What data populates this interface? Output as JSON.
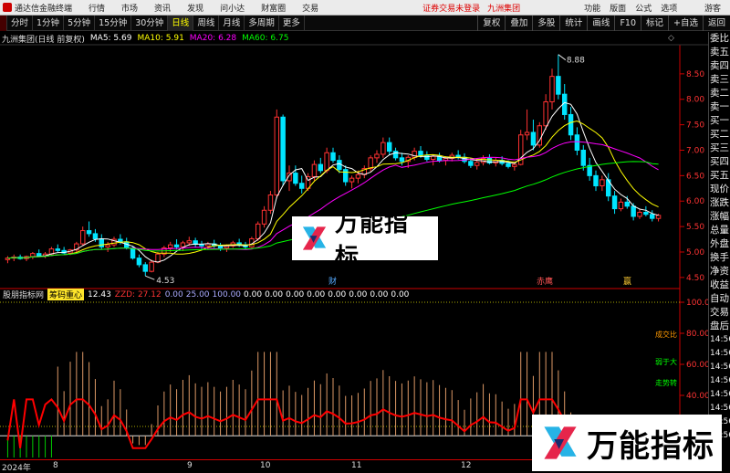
{
  "topbar": {
    "app_title": "通达信金融终端",
    "menus": [
      "行情",
      "市场",
      "资讯",
      "发现",
      "问小达",
      "财富圈",
      "交易"
    ],
    "notice": "证券交易未登录",
    "stock_name": "九洲集团",
    "right_menus": [
      "功能",
      "版面",
      "公式",
      "选项"
    ],
    "guest": "游客"
  },
  "periodbar": {
    "periods": [
      "分时",
      "1分钟",
      "5分钟",
      "15分钟",
      "30分钟",
      "日线",
      "周线",
      "月线",
      "多周期",
      "更多"
    ],
    "active": "日线",
    "right_buttons": [
      "复权",
      "叠加",
      "多股",
      "统计",
      "画线",
      "F10",
      "标记",
      "+自选",
      "返回"
    ]
  },
  "price_chart": {
    "title": "九洲集团(日线 前复权)",
    "ma": [
      {
        "label": "MA5: 5.69",
        "color": "#ffffff"
      },
      {
        "label": "MA10: 5.91",
        "color": "#ffff00"
      },
      {
        "label": "MA20: 6.28",
        "color": "#ff00ff"
      },
      {
        "label": "MA60: 6.75",
        "color": "#00ff00"
      }
    ],
    "high_label": "8.88",
    "low_label": "4.53",
    "y_ticks": [
      "8.50",
      "8.00",
      "7.50",
      "7.00",
      "6.50",
      "6.00",
      "5.50",
      "5.00",
      "4.50"
    ],
    "markers": [
      "财",
      "赤鹰",
      "赢"
    ]
  },
  "indicator": {
    "source": "股朋指标网",
    "tag": "筹码重心",
    "value": "12.43",
    "zzd": "ZZD: 27.12",
    "params": [
      "0.00",
      "25.00",
      "100.00",
      "0.00",
      "0.00",
      "0.00",
      "0.00",
      "0.00",
      "0.00",
      "0.00",
      "0.00"
    ],
    "y_ticks": [
      "100.00",
      "80.00",
      "60.00",
      "40.00",
      "20.00"
    ],
    "side_labels": [
      "成交比",
      "弱于大",
      "走势转"
    ]
  },
  "date_axis": [
    "2024年",
    "8",
    "9",
    "10",
    "11",
    "12"
  ],
  "right_panel": [
    "委比",
    "卖五",
    "卖四",
    "卖三",
    "卖二",
    "卖一",
    "买一",
    "买二",
    "买三",
    "买四",
    "买五",
    "现价",
    "涨跌",
    "涨幅",
    "总量",
    "外盘",
    "换手",
    "净资",
    "收益",
    "自动",
    "交易",
    "盘后",
    "14:56",
    "14:56",
    "14:56",
    "14:56",
    "14:56",
    "14:56",
    "14:56",
    "14:56"
  ],
  "watermark": "万能指标",
  "chart_data": [
    {
      "type": "candlestick",
      "title": "九洲集团(日线 前复权)",
      "ylim": [
        4.3,
        9.0
      ],
      "ohlc": [
        [
          4.85,
          4.92,
          4.78,
          4.88
        ],
        [
          4.88,
          4.95,
          4.82,
          4.9
        ],
        [
          4.9,
          4.95,
          4.85,
          4.87
        ],
        [
          4.87,
          4.93,
          4.82,
          4.91
        ],
        [
          4.91,
          5.0,
          4.86,
          4.97
        ],
        [
          4.97,
          5.05,
          4.9,
          4.92
        ],
        [
          4.92,
          5.0,
          4.88,
          4.96
        ],
        [
          4.96,
          5.1,
          4.93,
          5.06
        ],
        [
          5.06,
          5.15,
          5.0,
          5.03
        ],
        [
          5.03,
          5.1,
          4.96,
          4.98
        ],
        [
          4.98,
          5.06,
          4.94,
          5.04
        ],
        [
          5.04,
          5.2,
          5.0,
          5.16
        ],
        [
          5.16,
          5.5,
          5.12,
          5.42
        ],
        [
          5.42,
          5.6,
          5.3,
          5.36
        ],
        [
          5.36,
          5.45,
          5.2,
          5.26
        ],
        [
          5.26,
          5.35,
          5.05,
          5.1
        ],
        [
          5.1,
          5.2,
          5.0,
          5.14
        ],
        [
          5.14,
          5.3,
          5.1,
          5.25
        ],
        [
          5.25,
          5.35,
          5.15,
          5.2
        ],
        [
          5.2,
          5.28,
          5.05,
          5.08
        ],
        [
          5.08,
          5.12,
          4.85,
          4.88
        ],
        [
          4.88,
          4.95,
          4.7,
          4.75
        ],
        [
          4.75,
          4.8,
          4.53,
          4.62
        ],
        [
          4.62,
          4.85,
          4.6,
          4.8
        ],
        [
          4.8,
          5.0,
          4.78,
          4.96
        ],
        [
          4.96,
          5.12,
          4.9,
          5.08
        ],
        [
          5.08,
          5.2,
          5.0,
          5.14
        ],
        [
          5.14,
          5.25,
          5.05,
          5.1
        ],
        [
          5.1,
          5.22,
          5.02,
          5.18
        ],
        [
          5.18,
          5.3,
          5.12,
          5.22
        ],
        [
          5.22,
          5.28,
          5.1,
          5.15
        ],
        [
          5.15,
          5.22,
          5.05,
          5.12
        ],
        [
          5.12,
          5.2,
          5.04,
          5.16
        ],
        [
          5.16,
          5.24,
          5.08,
          5.12
        ],
        [
          5.12,
          5.18,
          5.02,
          5.08
        ],
        [
          5.08,
          5.15,
          5.0,
          5.12
        ],
        [
          5.12,
          5.22,
          5.08,
          5.18
        ],
        [
          5.18,
          5.26,
          5.1,
          5.14
        ],
        [
          5.14,
          5.2,
          5.06,
          5.1
        ],
        [
          5.1,
          5.3,
          5.08,
          5.26
        ],
        [
          5.26,
          5.6,
          5.22,
          5.55
        ],
        [
          5.55,
          5.9,
          5.48,
          5.82
        ],
        [
          5.82,
          6.2,
          5.75,
          6.12
        ],
        [
          6.12,
          7.8,
          6.05,
          7.65
        ],
        [
          7.65,
          7.7,
          6.3,
          6.4
        ],
        [
          6.4,
          6.7,
          6.2,
          6.55
        ],
        [
          6.55,
          6.7,
          6.3,
          6.35
        ],
        [
          6.35,
          6.5,
          6.15,
          6.25
        ],
        [
          6.25,
          6.55,
          6.2,
          6.48
        ],
        [
          6.48,
          6.8,
          6.4,
          6.72
        ],
        [
          6.72,
          6.85,
          6.55,
          6.6
        ],
        [
          6.6,
          7.05,
          6.55,
          6.95
        ],
        [
          6.95,
          7.05,
          6.75,
          6.8
        ],
        [
          6.8,
          6.9,
          6.55,
          6.62
        ],
        [
          6.62,
          6.7,
          6.3,
          6.38
        ],
        [
          6.38,
          6.5,
          6.25,
          6.45
        ],
        [
          6.45,
          6.6,
          6.35,
          6.52
        ],
        [
          6.52,
          6.7,
          6.45,
          6.64
        ],
        [
          6.64,
          6.9,
          6.58,
          6.85
        ],
        [
          6.85,
          7.0,
          6.75,
          6.92
        ],
        [
          6.92,
          7.25,
          6.85,
          7.15
        ],
        [
          7.15,
          7.25,
          6.9,
          6.98
        ],
        [
          6.98,
          7.05,
          6.8,
          6.85
        ],
        [
          6.85,
          6.95,
          6.7,
          6.78
        ],
        [
          6.78,
          6.9,
          6.65,
          6.86
        ],
        [
          6.86,
          7.05,
          6.8,
          6.98
        ],
        [
          6.98,
          7.08,
          6.85,
          6.9
        ],
        [
          6.9,
          6.98,
          6.78,
          6.82
        ],
        [
          6.82,
          6.92,
          6.7,
          6.88
        ],
        [
          6.88,
          6.95,
          6.76,
          6.8
        ],
        [
          6.8,
          6.88,
          6.7,
          6.84
        ],
        [
          6.84,
          6.95,
          6.78,
          6.9
        ],
        [
          6.9,
          7.0,
          6.82,
          6.86
        ],
        [
          6.86,
          6.94,
          6.74,
          6.78
        ],
        [
          6.78,
          6.85,
          6.65,
          6.7
        ],
        [
          6.7,
          6.82,
          6.62,
          6.76
        ],
        [
          6.76,
          6.9,
          6.7,
          6.84
        ],
        [
          6.84,
          6.92,
          6.72,
          6.75
        ],
        [
          6.75,
          6.86,
          6.68,
          6.8
        ],
        [
          6.8,
          6.88,
          6.7,
          6.74
        ],
        [
          6.74,
          6.8,
          6.64,
          6.68
        ],
        [
          6.68,
          6.75,
          6.6,
          6.72
        ],
        [
          6.72,
          7.4,
          6.7,
          7.3
        ],
        [
          7.3,
          7.8,
          7.2,
          7.35
        ],
        [
          7.35,
          7.6,
          7.0,
          7.1
        ],
        [
          7.1,
          7.55,
          7.05,
          7.48
        ],
        [
          7.48,
          8.1,
          7.4,
          7.95
        ],
        [
          7.95,
          8.6,
          7.8,
          8.45
        ],
        [
          8.45,
          8.88,
          8.0,
          8.1
        ],
        [
          8.1,
          8.3,
          7.6,
          7.7
        ],
        [
          7.7,
          7.85,
          7.2,
          7.3
        ],
        [
          7.3,
          7.45,
          6.9,
          7.0
        ],
        [
          7.0,
          7.1,
          6.6,
          6.7
        ],
        [
          6.7,
          6.85,
          6.4,
          6.5
        ],
        [
          6.5,
          6.6,
          6.2,
          6.3
        ],
        [
          6.3,
          6.5,
          6.2,
          6.42
        ],
        [
          6.42,
          6.55,
          6.0,
          6.1
        ],
        [
          6.1,
          6.2,
          5.75,
          5.85
        ],
        [
          5.85,
          6.05,
          5.8,
          5.98
        ],
        [
          5.98,
          6.1,
          5.85,
          5.9
        ],
        [
          5.9,
          5.96,
          5.62,
          5.7
        ],
        [
          5.7,
          5.85,
          5.65,
          5.78
        ],
        [
          5.78,
          5.9,
          5.7,
          5.74
        ],
        [
          5.74,
          5.82,
          5.6,
          5.66
        ],
        [
          5.66,
          5.75,
          5.6,
          5.72
        ]
      ]
    },
    {
      "type": "line",
      "title": "筹码重心",
      "ylim": [
        0,
        100
      ],
      "y_ticks": [
        100,
        80,
        60,
        40,
        20
      ]
    }
  ]
}
